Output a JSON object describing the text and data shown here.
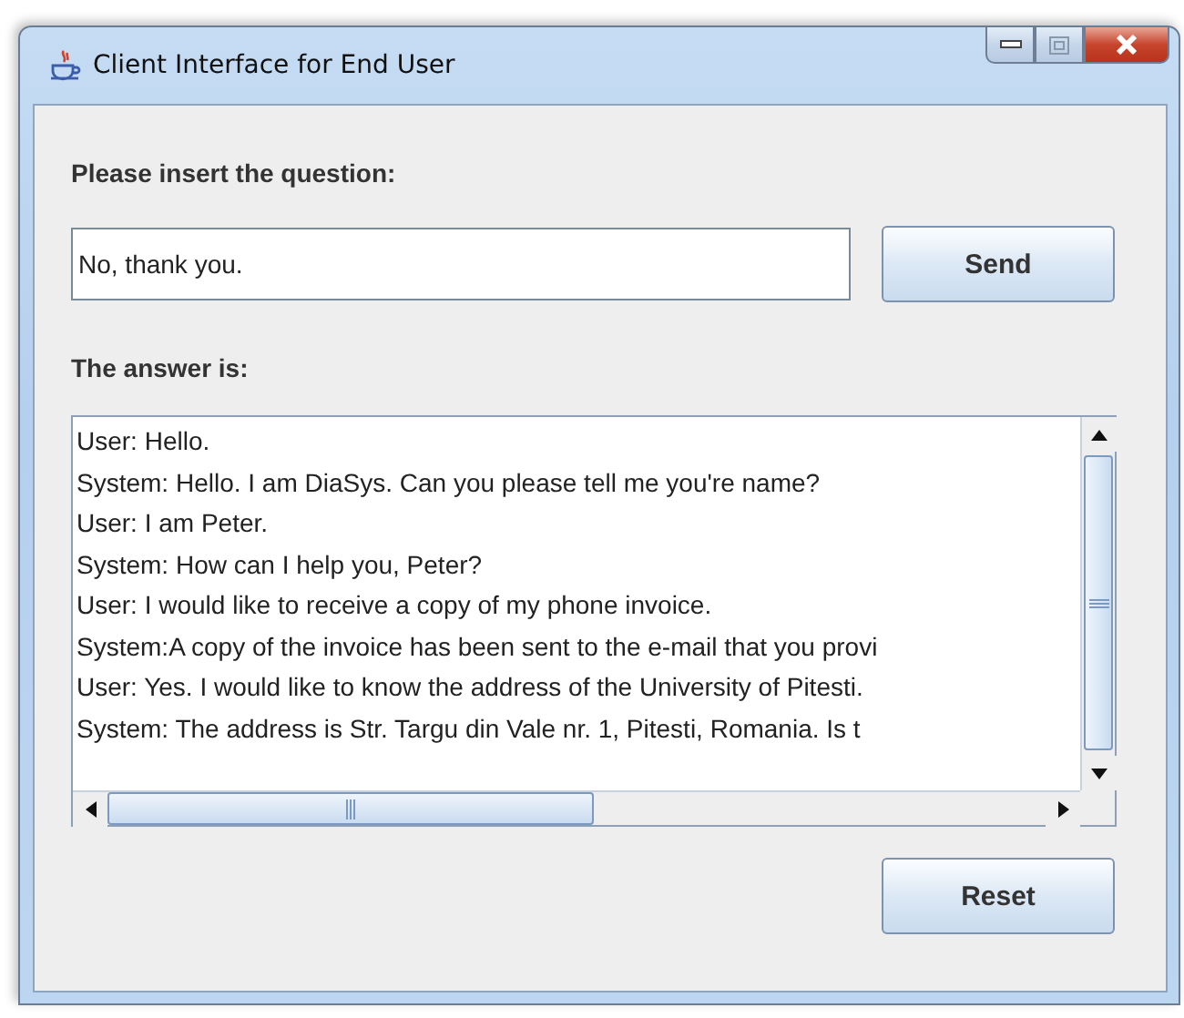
{
  "window": {
    "title": "Client Interface for End User"
  },
  "question": {
    "label": "Please insert the question:",
    "value": "No, thank you."
  },
  "send_button": "Send",
  "answer": {
    "label": "The answer is:",
    "lines": [
      "User: Hello.",
      "System: Hello. I am DiaSys. Can you please tell me you're name?",
      "User: I am Peter.",
      "System: How can I help you, Peter?",
      "User: I would like to receive a copy of my phone invoice.",
      "System:A copy of the invoice has been sent to the e-mail that you provi",
      "User: Yes. I would like to know the address of the University of Pitesti.",
      "System: The address is Str. Targu din Vale nr. 1, Pitesti, Romania. Is t"
    ]
  },
  "reset_button": "Reset"
}
